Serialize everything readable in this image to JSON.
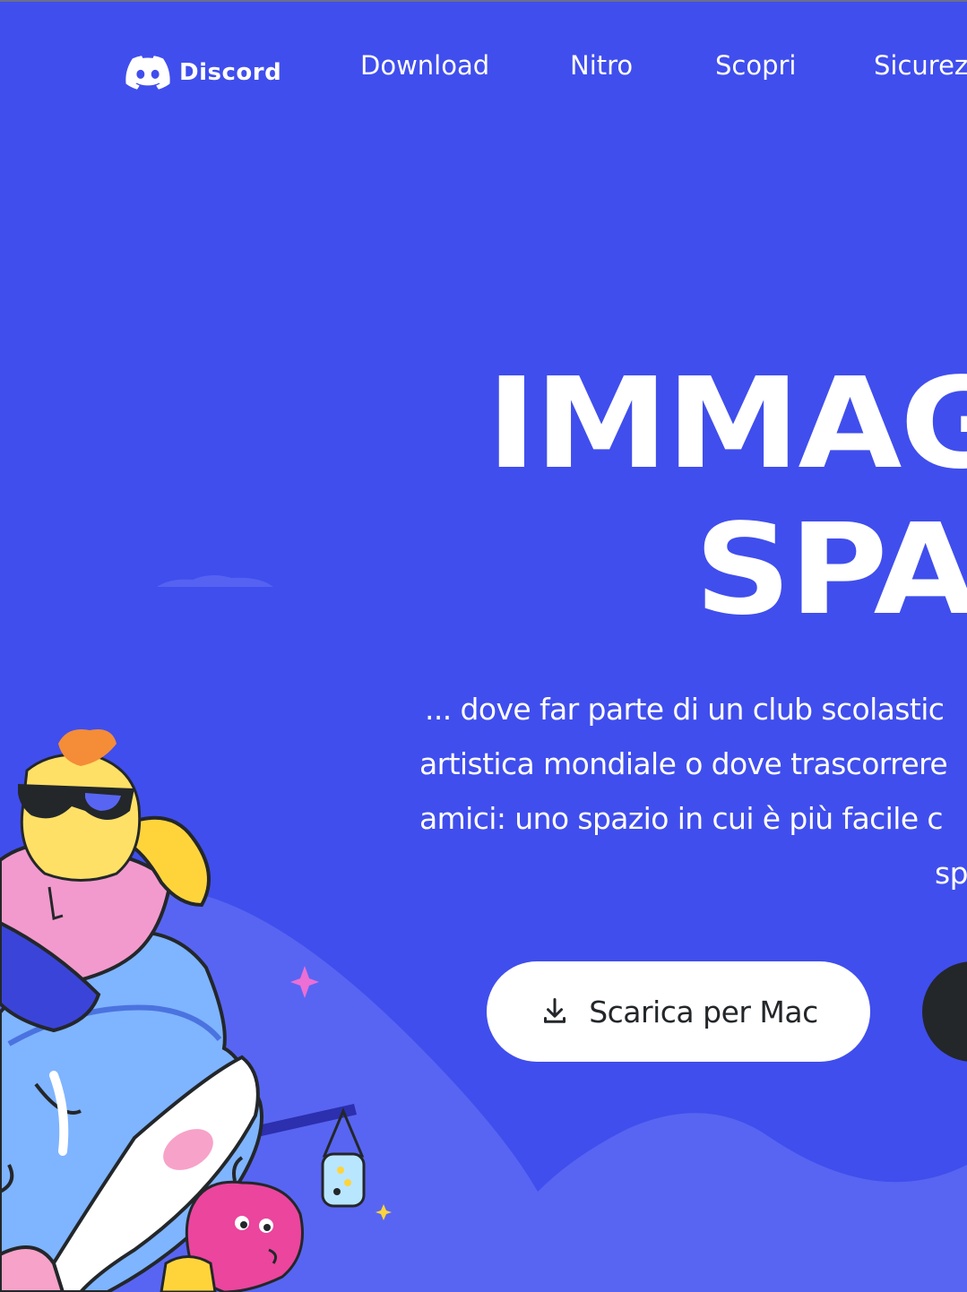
{
  "nav": {
    "brand": "Discord",
    "links": [
      "Download",
      "Nitro",
      "Scopri",
      "Sicurez"
    ]
  },
  "hero": {
    "headline_lines": [
      "IMMAGI",
      "SPAZ"
    ],
    "paragraph_lines": [
      "... dove far parte di un club scolastic",
      "artistica mondiale o dove trascorrere",
      "amici: uno spazio in cui è più facile c",
      "sp"
    ],
    "primary_cta": "Scarica per Mac",
    "secondary_cta": ""
  },
  "colors": {
    "background": "#404EED",
    "text": "#FFFFFF",
    "button_light": "#FFFFFF",
    "button_dark": "#23272A"
  },
  "icons": {
    "brand": "discord-logo-icon",
    "cta": "download-icon"
  }
}
